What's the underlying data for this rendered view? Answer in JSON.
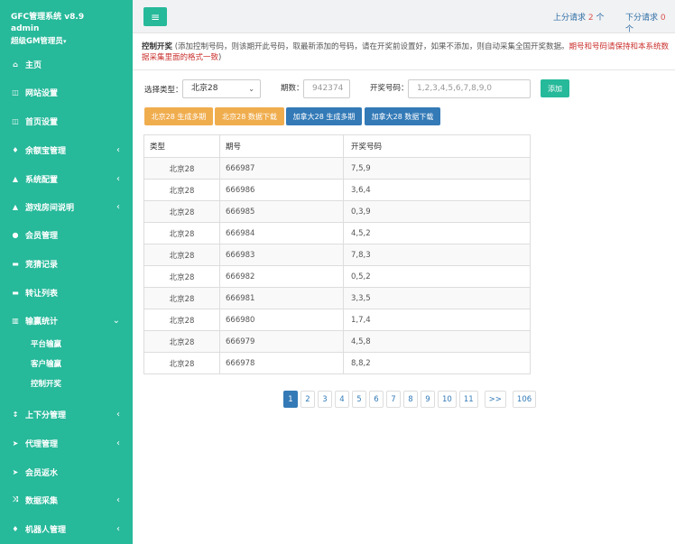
{
  "app": {
    "brand": "GFC管理系统 v8.9",
    "user_name": "admin",
    "user_role": "超级GM管理员"
  },
  "sidebar": {
    "items": [
      {
        "label": "主页",
        "icon": "home-icon",
        "glyph": "⌂",
        "has_children": false
      },
      {
        "label": "网站设置",
        "icon": "window-icon",
        "glyph": "◫",
        "has_children": false
      },
      {
        "label": "首页设置",
        "icon": "window-icon",
        "glyph": "◫",
        "has_children": false
      },
      {
        "label": "余额宝管理",
        "icon": "marker-icon",
        "glyph": "♦",
        "has_children": true
      },
      {
        "label": "系统配置",
        "icon": "flask-icon",
        "glyph": "▲",
        "has_children": true
      },
      {
        "label": "游戏房间说明",
        "icon": "flask-icon",
        "glyph": "▲",
        "has_children": true
      },
      {
        "label": "会员管理",
        "icon": "user-icon",
        "glyph": "●",
        "has_children": false
      },
      {
        "label": "竞猜记录",
        "icon": "car-icon",
        "glyph": "▬",
        "has_children": false
      },
      {
        "label": "转让列表",
        "icon": "car-icon",
        "glyph": "▬",
        "has_children": false
      },
      {
        "label": "输赢统计",
        "icon": "bar-chart-icon",
        "glyph": "▥",
        "has_children": true,
        "expanded": true
      },
      {
        "label": "上下分管理",
        "icon": "arrow-up-icon",
        "glyph": "↕",
        "has_children": true
      },
      {
        "label": "代理管理",
        "icon": "send-icon",
        "glyph": "➤",
        "has_children": true
      },
      {
        "label": "会员返水",
        "icon": "send-icon",
        "glyph": "➤",
        "has_children": false
      },
      {
        "label": "数据采集",
        "icon": "shuffle-icon",
        "glyph": "⤨",
        "has_children": true
      },
      {
        "label": "机器人管理",
        "icon": "marker-icon",
        "glyph": "♦",
        "has_children": true
      }
    ],
    "sub_items": [
      "平台输赢",
      "客户输赢",
      "控制开奖"
    ]
  },
  "topbar": {
    "menu_icon": "hamburger-icon",
    "up_label": "上分请求",
    "up_count": "2",
    "up_unit": "个",
    "down_label": "下分请求",
    "down_count": "0",
    "down_unit": "个"
  },
  "notice": {
    "title": "控制开奖",
    "text": "(添加控制号码，则该期开此号码，取最新添加的号码，请在开奖前设置好，如果不添加，则自动采集全国开奖数据。",
    "red_text": "期号和号码请保持和本系统数据采集里面的格式一致",
    "end": ")"
  },
  "form": {
    "type_label": "选择类型：",
    "type_value": "北京28",
    "period_label": "期数：",
    "period_placeholder": "942374",
    "numbers_label": "开奖号码：",
    "numbers_placeholder": "1,2,3,4,5,6,7,8,9,0",
    "add_button": "添加"
  },
  "actions": {
    "btn1": "北京28 生成多期",
    "btn2": "北京28 数据下载",
    "btn3": "加拿大28 生成多期",
    "btn4": "加拿大28 数据下载"
  },
  "table": {
    "headers": [
      "类型",
      "期号",
      "开奖号码"
    ],
    "rows": [
      [
        "北京28",
        "666987",
        "7,5,9"
      ],
      [
        "北京28",
        "666986",
        "3,6,4"
      ],
      [
        "北京28",
        "666985",
        "0,3,9"
      ],
      [
        "北京28",
        "666984",
        "4,5,2"
      ],
      [
        "北京28",
        "666983",
        "7,8,3"
      ],
      [
        "北京28",
        "666982",
        "0,5,2"
      ],
      [
        "北京28",
        "666981",
        "3,3,5"
      ],
      [
        "北京28",
        "666980",
        "1,7,4"
      ],
      [
        "北京28",
        "666979",
        "4,5,8"
      ],
      [
        "北京28",
        "666978",
        "8,8,2"
      ]
    ]
  },
  "pagination": {
    "pages": [
      "1",
      "2",
      "3",
      "4",
      "5",
      "6",
      "7",
      "8",
      "9",
      "10",
      "11"
    ],
    "active": "1",
    "next": ">>",
    "last": "106"
  },
  "colors": {
    "sidebar": "#26b99a",
    "accent_green": "#26b99a",
    "orange": "#f0ad4e",
    "blue": "#337ab7",
    "red": "#c9302c"
  }
}
